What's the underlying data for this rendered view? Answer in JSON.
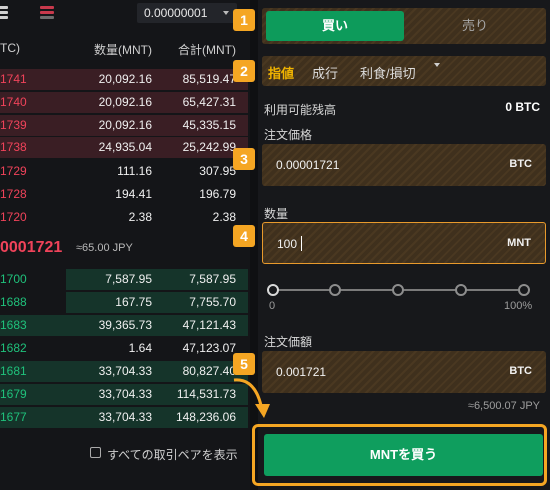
{
  "book": {
    "precision": "0.00000001",
    "headers": {
      "price": "TC)",
      "qty": "数量(MNT)",
      "total": "合計(MNT)"
    },
    "asks": [
      {
        "price": "1741",
        "qty": "20,092.16",
        "total": "85,519.47"
      },
      {
        "price": "1740",
        "qty": "20,092.16",
        "total": "65,427.31"
      },
      {
        "price": "1739",
        "qty": "20,092.16",
        "total": "45,335.15"
      },
      {
        "price": "1738",
        "qty": "24,935.04",
        "total": "25,242.99"
      },
      {
        "price": "1729",
        "qty": "111.16",
        "total": "307.95"
      },
      {
        "price": "1728",
        "qty": "194.41",
        "total": "196.79"
      },
      {
        "price": "1720",
        "qty": "2.38",
        "total": "2.38"
      }
    ],
    "last_price": "0001721",
    "last_price_jpy": "≈65.00 JPY",
    "bids": [
      {
        "price": "1700",
        "qty": "7,587.95",
        "total": "7,587.95"
      },
      {
        "price": "1688",
        "qty": "167.75",
        "total": "7,755.70"
      },
      {
        "price": "1683",
        "qty": "39,365.73",
        "total": "47,121.43"
      },
      {
        "price": "1682",
        "qty": "1.64",
        "total": "47,123.07"
      },
      {
        "price": "1681",
        "qty": "33,704.33",
        "total": "80,827.40"
      },
      {
        "price": "1679",
        "qty": "33,704.33",
        "total": "114,531.73"
      },
      {
        "price": "1677",
        "qty": "33,704.33",
        "total": "148,236.06"
      }
    ],
    "show_all_pairs_label": "すべての取引ペアを表示"
  },
  "form": {
    "buy_tab": "買い",
    "sell_tab": "売り",
    "order_types": {
      "limit": "指値",
      "market": "成行",
      "tp_sl": "利食/損切"
    },
    "available_label": "利用可能残高",
    "available_value": "0 BTC",
    "price_label": "注文価格",
    "price_value": "0.00001721",
    "price_unit": "BTC",
    "qty_label": "数量",
    "qty_value": "100",
    "qty_unit": "MNT",
    "slider": {
      "min_label": "0",
      "max_label": "100%",
      "level_percent": 0
    },
    "total_label": "注文価額",
    "total_value": "0.001721",
    "total_unit": "BTC",
    "total_jpy": "≈6,500.07 JPY",
    "submit": "MNTを買う"
  },
  "steps": [
    "1",
    "2",
    "3",
    "4",
    "5"
  ],
  "colors": {
    "ask": "#f0435a",
    "bid": "#1fc17b",
    "buy": "#0f9e5e",
    "highlight": "#f5a623",
    "active_type": "#f1b400"
  }
}
